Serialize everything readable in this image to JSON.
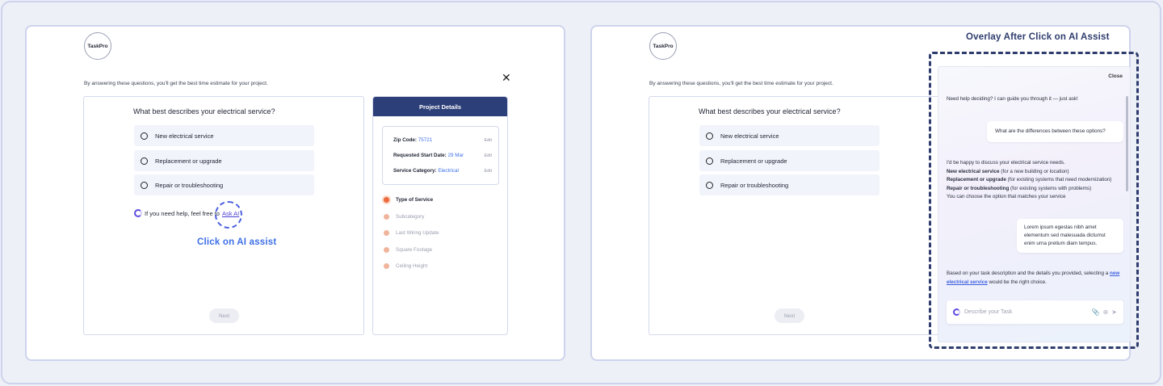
{
  "brand": "TaskPro",
  "intro": "By answering these questions, you'll get the best time estimate for your project.",
  "close_symbol": "✕",
  "question": {
    "title": "What best describes your electrical service?",
    "options": [
      "New electrical service",
      "Replacement or upgrade",
      "Repair or troubleshooting"
    ],
    "help_text": "If you need help, feel free to",
    "ask_ai_label": "Ask AI",
    "next_label": "Next"
  },
  "annotation": {
    "click_label": "Click on AI assist",
    "overlay_title": "Overlay After Click on AI Assist"
  },
  "project_details": {
    "title": "Project Details",
    "rows": [
      {
        "label": "Zip Code:",
        "value": "75721",
        "edit": "Edit"
      },
      {
        "label": "Requested Start Date:",
        "value": "29 Mar",
        "edit": "Edit"
      },
      {
        "label": "Service Category:",
        "value": "Electrical",
        "edit": "Edit"
      }
    ],
    "steps": [
      "Type of Service",
      "Subcategory",
      "Last Wiring Update",
      "Square Footage",
      "Ceiling Height"
    ],
    "active_step": "Type of Service"
  },
  "assistant": {
    "close_label": "Close",
    "greeting": "Need help deciding? I can guide you through it — just ask!",
    "user_q": "What are the differences between these options?",
    "reply_intro": "I'd be happy to discuss your electrical service needs.",
    "reply_items": [
      {
        "b": "New electrical service",
        "t": " (for a new building or location)"
      },
      {
        "b": "Replacement or upgrade",
        "t": " (for existing systems that need modernization)"
      },
      {
        "b": "Repair or troubleshooting",
        "t": " (for existing systems with problems)"
      }
    ],
    "reply_outro": "You can choose the option that matches your service",
    "user_msg2": "Lorem ipsum egestas nibh amet elementum sed malesuada dictumst enim urna pretium diam tempus.",
    "final_pre": "Based on your task description and the details you provided, selecting a",
    "final_link": "new electrical service",
    "final_post": " would be the right choice.",
    "input_placeholder": "Describe your Task",
    "icons": [
      "paperclip-icon",
      "plus-circle-icon",
      "send-icon"
    ]
  }
}
